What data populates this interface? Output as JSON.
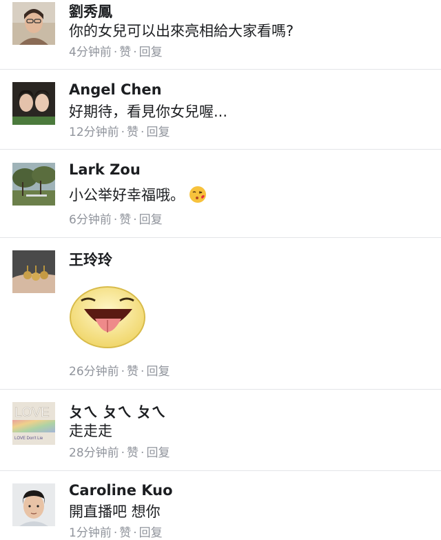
{
  "comments": [
    {
      "name": "劉秀鳳",
      "text": "你的女兒可以出來亮相給大家看嗎?",
      "time": "4分钟前",
      "like": "赞",
      "reply": "回复",
      "avatar": "woman-with-glasses-avatar"
    },
    {
      "name": "Angel Chen",
      "text": "好期待，看見你女兒喔...",
      "time": "12分钟前",
      "like": "赞",
      "reply": "回复",
      "avatar": "two-women-selfie-avatar"
    },
    {
      "name": "Lark Zou",
      "text": "小公举好幸福哦。",
      "time": "6分钟前",
      "like": "赞",
      "reply": "回复",
      "avatar": "trees-landscape-avatar",
      "emoji": "kissing-face-emoji"
    },
    {
      "name": "王玲玲",
      "text": "",
      "time": "26分钟前",
      "like": "赞",
      "reply": "回复",
      "avatar": "earrings-hand-avatar",
      "sticker": "tongue-out-smiley-sticker"
    },
    {
      "name": "ㄆㄟ ㄆㄟ ㄆㄟ",
      "text": "走走走",
      "time": "28分钟前",
      "like": "赞",
      "reply": "回复",
      "avatar": "love-rainbow-avatar",
      "avatar_text": "LOVE",
      "avatar_subtext": "LOVE Don't Lie"
    },
    {
      "name": "Caroline Kuo",
      "text": "開直播吧 想你",
      "time": "1分钟前",
      "like": "赞",
      "reply": "回复",
      "avatar": "boy-portrait-avatar"
    }
  ],
  "meta_separator": "·",
  "colors": {
    "meta": "#90949c",
    "divider": "#e3e5e8",
    "name": "#1c1e21"
  }
}
